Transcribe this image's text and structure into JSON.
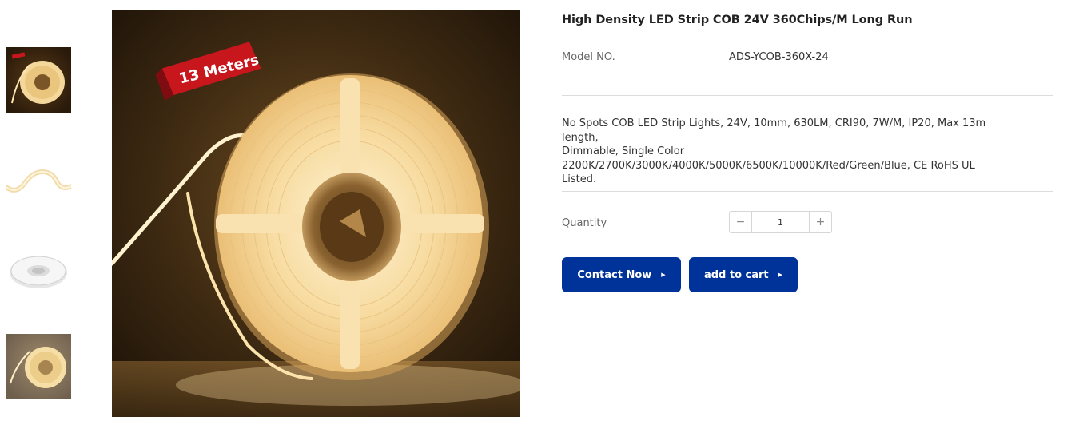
{
  "gallery": {
    "badge_text": "13 Meters",
    "thumbnails": [
      "reel-lit-thumb",
      "strip-wave-thumb",
      "reel-white-thumb",
      "reel-lit-grey-thumb"
    ]
  },
  "product": {
    "title": "High Density LED Strip COB 24V 360Chips/M Long Run",
    "model_label": "Model NO.",
    "model_value": "ADS-YCOB-360X-24",
    "description_lines": [
      "No Spots COB LED Strip Lights, 24V, 10mm, 630LM, CRI90, 7W/M, IP20, Max 13m length,",
      "Dimmable, Single Color",
      "2200K/2700K/3000K/4000K/5000K/6500K/10000K/Red/Green/Blue, CE RoHS UL",
      "Listed."
    ]
  },
  "quantity": {
    "label": "Quantity",
    "value": "1",
    "minus_symbol": "−",
    "plus_symbol": "+"
  },
  "actions": {
    "contact_label": "Contact Now",
    "cart_label": "add to cart",
    "arrow_symbol": "▶"
  },
  "colors": {
    "primary_button": "#003399",
    "divider": "#dcdcdc",
    "badge_red": "#c8161d"
  }
}
